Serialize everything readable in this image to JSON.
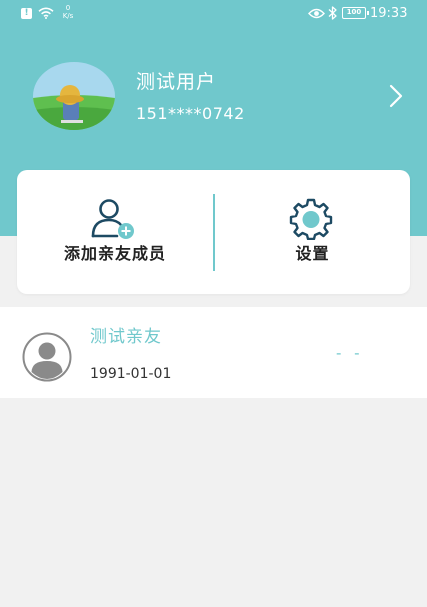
{
  "colors": {
    "accent": "#70c8cc",
    "background": "#f1f1f1",
    "card": "#ffffff",
    "text": "#222222"
  },
  "status_bar": {
    "alert_icon": "alert-icon",
    "alert_glyph": "!",
    "wifi_icon": "wifi-icon",
    "speed_value": "0",
    "speed_unit": "K/s",
    "eye_icon": "eye-icon",
    "bluetooth_icon": "bluetooth-icon",
    "battery_level": "100",
    "time": "19:33"
  },
  "profile": {
    "avatar_icon": "profile-avatar-image",
    "name": "测试用户",
    "phone": "151****0742",
    "chevron_icon": "chevron-right-icon"
  },
  "actions": {
    "add_member": {
      "icon": "add-user-icon",
      "label": "添加亲友成员"
    },
    "settings": {
      "icon": "gear-icon",
      "label": "设置"
    }
  },
  "members": [
    {
      "avatar_icon": "default-avatar-icon",
      "name": "测试亲友",
      "birth_date": "1991-01-01",
      "status": "- -"
    }
  ]
}
